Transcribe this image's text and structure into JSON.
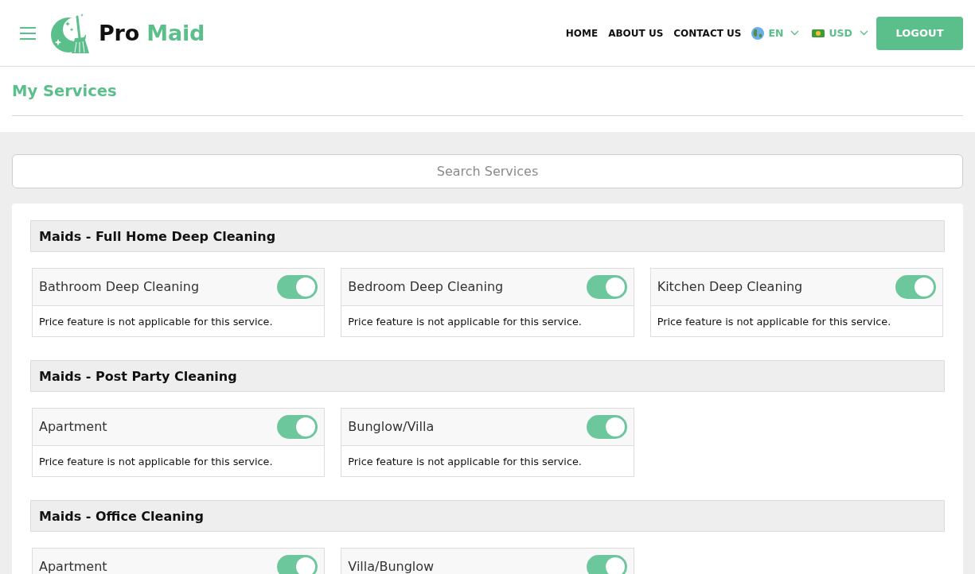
{
  "header": {
    "brand": {
      "first": "Pro",
      "second": "Maid"
    },
    "nav": [
      "HOME",
      "ABOUT US",
      "CONTACT US"
    ],
    "language": "EN",
    "currency": "USD",
    "logout": "LOGOUT"
  },
  "page_title": "My Services",
  "search": {
    "placeholder": "Search Services"
  },
  "groups": [
    {
      "title": "Maids - Full Home Deep Cleaning",
      "services": [
        {
          "name": "Bathroom Deep Cleaning",
          "on": true,
          "note": "Price feature is not applicable for this service."
        },
        {
          "name": "Bedroom Deep Cleaning",
          "on": true,
          "note": "Price feature is not applicable for this service."
        },
        {
          "name": "Kitchen Deep Cleaning",
          "on": true,
          "note": "Price feature is not applicable for this service."
        }
      ]
    },
    {
      "title": "Maids - Post Party Cleaning",
      "services": [
        {
          "name": "Apartment",
          "on": true,
          "note": "Price feature is not applicable for this service."
        },
        {
          "name": "Bunglow/Villa",
          "on": true,
          "note": "Price feature is not applicable for this service."
        }
      ]
    },
    {
      "title": "Maids - Office Cleaning",
      "services": [
        {
          "name": "Apartment",
          "on": true
        },
        {
          "name": "Villa/Bunglow",
          "on": true
        }
      ]
    }
  ]
}
